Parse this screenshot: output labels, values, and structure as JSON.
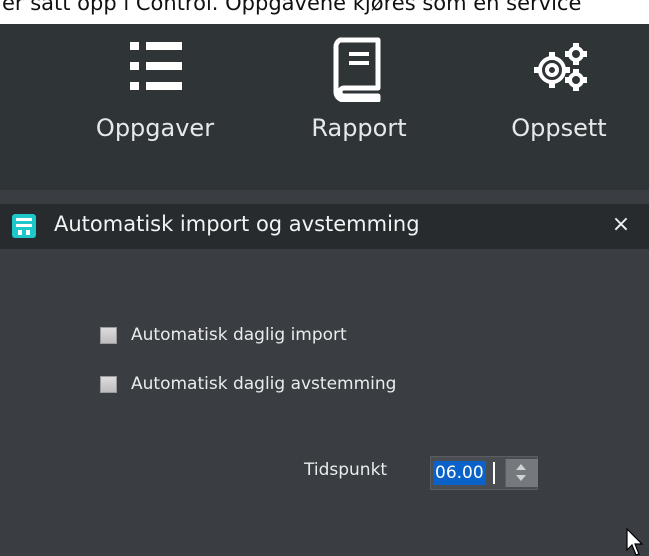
{
  "background_text": "er satt opp i Control. Oppgavene kjøres som en service",
  "toolbar": {
    "items": [
      {
        "label": "Oppgaver",
        "icon": "list-icon"
      },
      {
        "label": "Rapport",
        "icon": "book-icon"
      },
      {
        "label": "Oppsett",
        "icon": "gears-icon"
      }
    ]
  },
  "panel": {
    "title": "Automatisk import og avstemming",
    "close": "×",
    "checkboxes": [
      {
        "label": "Automatisk daglig import",
        "checked": false
      },
      {
        "label": "Automatisk daglig avstemming",
        "checked": false
      }
    ],
    "time": {
      "label": "Tidspunkt",
      "value": "06.00"
    }
  },
  "colors": {
    "toolbar_bg": "#2f3437",
    "panel_bg": "#3a3e42",
    "header_bg": "#272b2e",
    "accent": "#1ec8c8",
    "selection": "#0a62c9"
  }
}
